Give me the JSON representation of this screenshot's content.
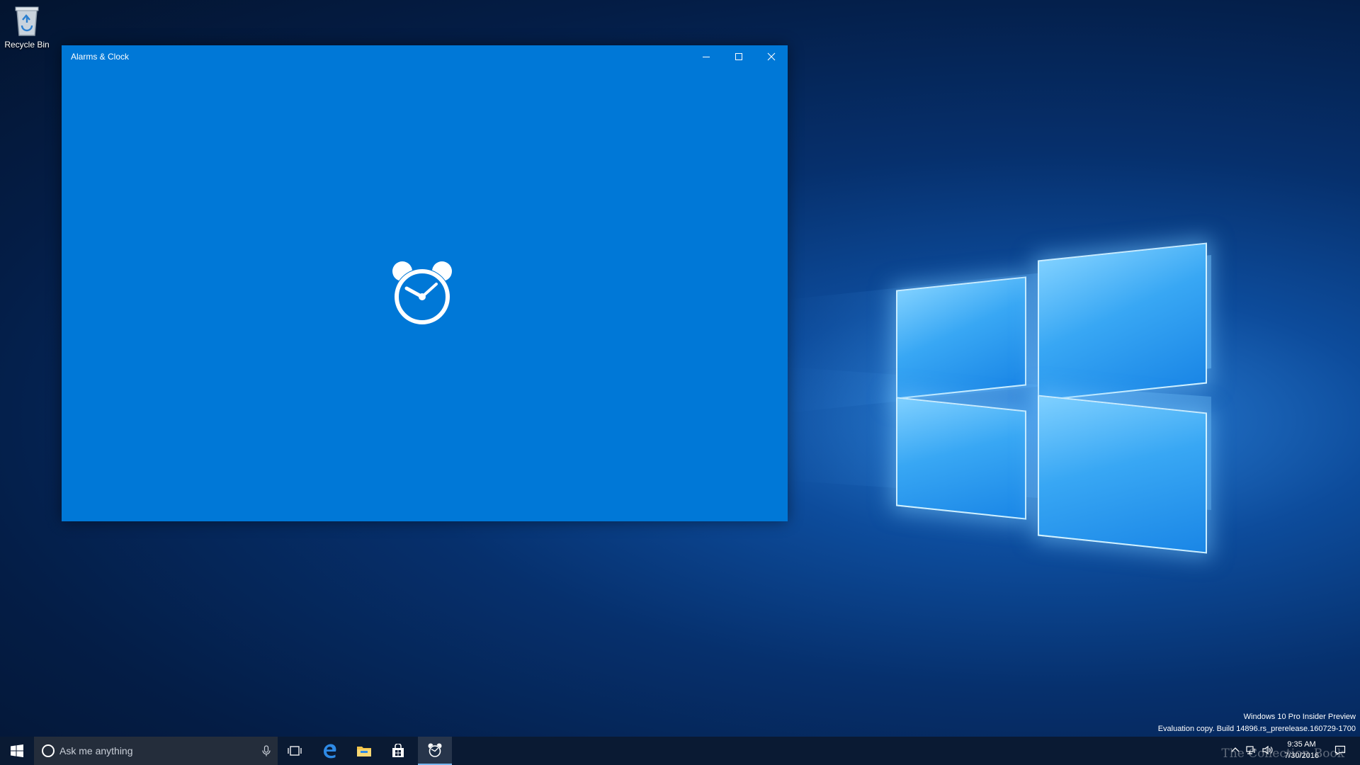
{
  "desktop": {
    "recycle_bin_label": "Recycle Bin"
  },
  "app_window": {
    "title": "Alarms & Clock",
    "minimize_icon": "minimize-icon",
    "maximize_icon": "maximize-icon",
    "close_icon": "close-icon",
    "splash_icon": "alarm-clock-icon",
    "accent_color": "#0078d7"
  },
  "watermark": {
    "line1": "Windows 10 Pro Insider Preview",
    "line2": "Evaluation copy. Build 14896.rs_prerelease.160729-1700"
  },
  "taskbar": {
    "search_placeholder": "Ask me anything",
    "apps": [
      "task-view-icon",
      "edge-icon",
      "file-explorer-icon",
      "store-icon",
      "alarms-clock-icon"
    ],
    "time": "9:35 AM",
    "date": "7/30/2016",
    "corner_text": "The Collection Book",
    "background_color": "#0a1a33"
  }
}
